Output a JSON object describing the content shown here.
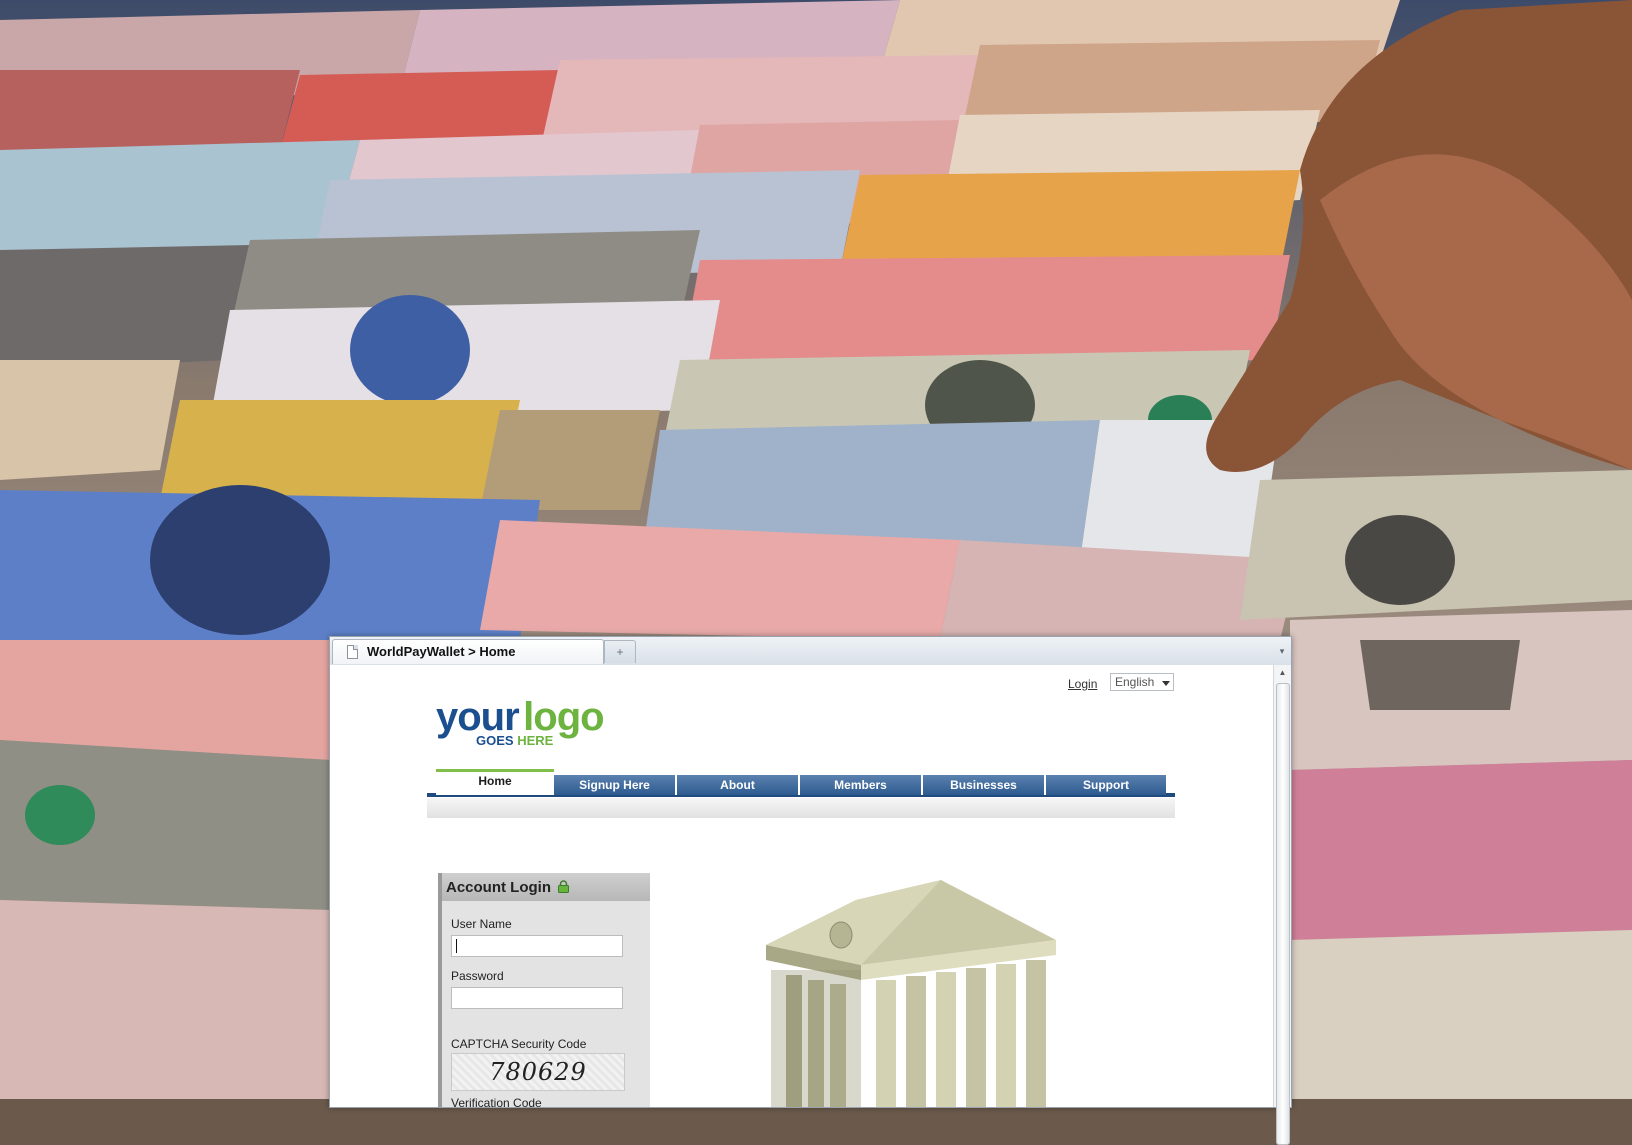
{
  "browser": {
    "tab_title": "WorldPayWallet > Home",
    "new_tab_symbol": "+",
    "tab_menu_symbol": "▾",
    "scroll_up_symbol": "▲"
  },
  "header": {
    "login_link": "Login",
    "language": "English"
  },
  "logo": {
    "word1": "your",
    "word2": "logo",
    "tag1": "GOES",
    "tag2": "HERE"
  },
  "nav": {
    "items": [
      {
        "label": "Home",
        "active": true
      },
      {
        "label": "Signup Here"
      },
      {
        "label": "About"
      },
      {
        "label": "Members"
      },
      {
        "label": "Businesses"
      },
      {
        "label": "Support"
      }
    ]
  },
  "login": {
    "title": "Account Login",
    "username_label": "User Name",
    "username_value": "",
    "password_label": "Password",
    "password_value": "",
    "captcha_label": "CAPTCHA Security Code",
    "captcha_code": "780629",
    "verification_label": "Verification Code"
  },
  "colors": {
    "brand_blue": "#1b4f8f",
    "brand_green": "#6cb33f",
    "nav_blue": "#2d5a8f"
  }
}
